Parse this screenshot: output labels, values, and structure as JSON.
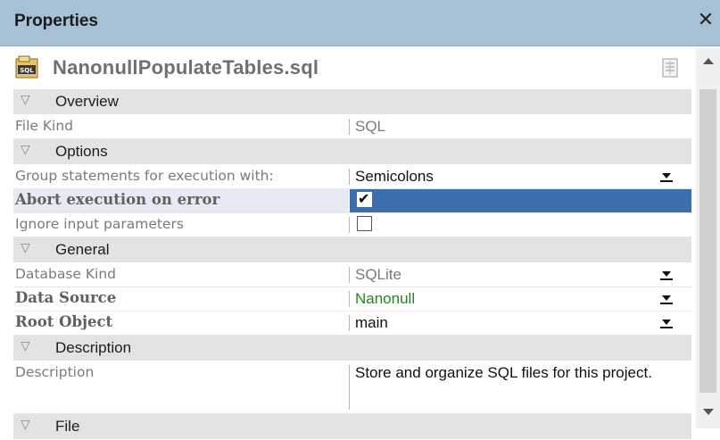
{
  "panel": {
    "title": "Properties",
    "close_label": "✕"
  },
  "file": {
    "name": "NanonullPopulateTables.sql",
    "icon": "sql-file-icon"
  },
  "sections": {
    "overview": "Overview",
    "options": "Options",
    "general": "General",
    "description": "Description",
    "file": "File"
  },
  "rows": {
    "file_kind": {
      "label": "File Kind",
      "value": "SQL"
    },
    "group_statements": {
      "label": "Group statements for execution with:",
      "value": "Semicolons"
    },
    "abort_on_error": {
      "label": "Abort execution on error",
      "checked": true
    },
    "ignore_params": {
      "label": "Ignore input parameters",
      "checked": false
    },
    "database_kind": {
      "label": "Database Kind",
      "value": "SQLite"
    },
    "data_source": {
      "label": "Data Source",
      "value": "Nanonull"
    },
    "root_object": {
      "label": "Root Object",
      "value": "main"
    },
    "description": {
      "label": "Description",
      "value": "Store and organize SQL files for this project."
    }
  },
  "colors": {
    "titlebar": "#a7c0d6",
    "selection": "#3d6fae",
    "green_value": "#1e8a1e"
  }
}
